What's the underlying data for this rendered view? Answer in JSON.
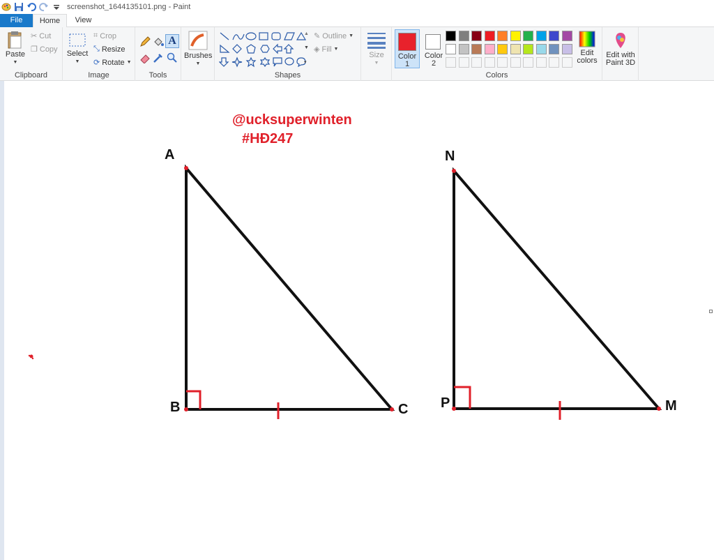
{
  "window": {
    "title": "screenshot_1644135101.png - Paint"
  },
  "tabs": {
    "file": "File",
    "home": "Home",
    "view": "View"
  },
  "clipboard": {
    "paste": "Paste",
    "cut": "Cut",
    "copy": "Copy",
    "label": "Clipboard"
  },
  "image": {
    "select": "Select",
    "crop": "Crop",
    "resize": "Resize",
    "rotate": "Rotate",
    "label": "Image"
  },
  "tools": {
    "label": "Tools"
  },
  "brushes": {
    "label": "Brushes"
  },
  "shapes": {
    "label": "Shapes",
    "outline": "Outline",
    "fill": "Fill"
  },
  "size": {
    "label": "Size"
  },
  "colors": {
    "color1": "Color 1",
    "color1_line1": "Color",
    "color1_line2": "1",
    "color2_line1": "Color",
    "color2_line2": "2",
    "edit": "Edit colors",
    "edit_line1": "Edit",
    "edit_line2": "colors",
    "label": "Colors",
    "color1_value": "#e8222c",
    "color2_value": "#ffffff",
    "palette_row1": [
      "#000000",
      "#7f7f7f",
      "#880015",
      "#ed1c24",
      "#ff7f27",
      "#fff200",
      "#22b14c",
      "#00a2e8",
      "#3f48cc",
      "#a349a4"
    ],
    "palette_row2": [
      "#ffffff",
      "#c3c3c3",
      "#b97a57",
      "#ffaec9",
      "#ffc90e",
      "#efe4b0",
      "#b5e61d",
      "#99d9ea",
      "#7092be",
      "#c8bfe7"
    ],
    "palette_row3": [
      "#f5f6f7",
      "#f5f6f7",
      "#f5f6f7",
      "#f5f6f7",
      "#f5f6f7",
      "#f5f6f7",
      "#f5f6f7",
      "#f5f6f7",
      "#f5f6f7",
      "#f5f6f7"
    ]
  },
  "paint3d": {
    "line1": "Edit with",
    "line2": "Paint 3D"
  },
  "drawing": {
    "watermark_line1": "@ucksuperwinten",
    "watermark_line2": "#HĐ247",
    "triangle1": {
      "a": "A",
      "b": "B",
      "c": "C"
    },
    "triangle2": {
      "n": "N",
      "p": "P",
      "m": "M"
    }
  }
}
